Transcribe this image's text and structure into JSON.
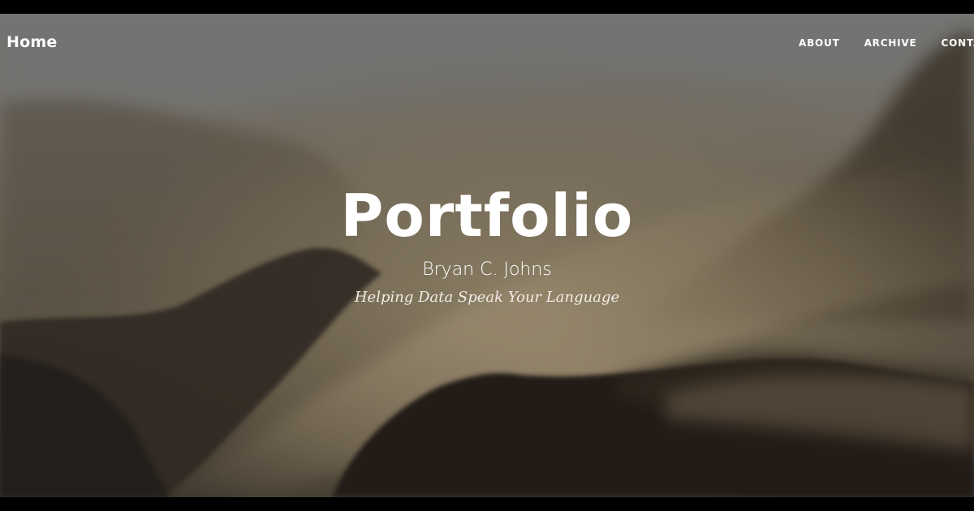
{
  "nav": {
    "brand": "Home",
    "links": [
      "ABOUT",
      "ARCHIVE",
      "CONTACT"
    ]
  },
  "header": {
    "title": "Portfolio",
    "subtitle": "Bryan C. Johns",
    "tagline": "Helping Data Speak Your Language"
  },
  "colors": {
    "frame": "#000000",
    "sky": "#8b8a87",
    "mist": "#a89a80",
    "mountain_dark": "#2a2520",
    "text": "#ffffff"
  }
}
